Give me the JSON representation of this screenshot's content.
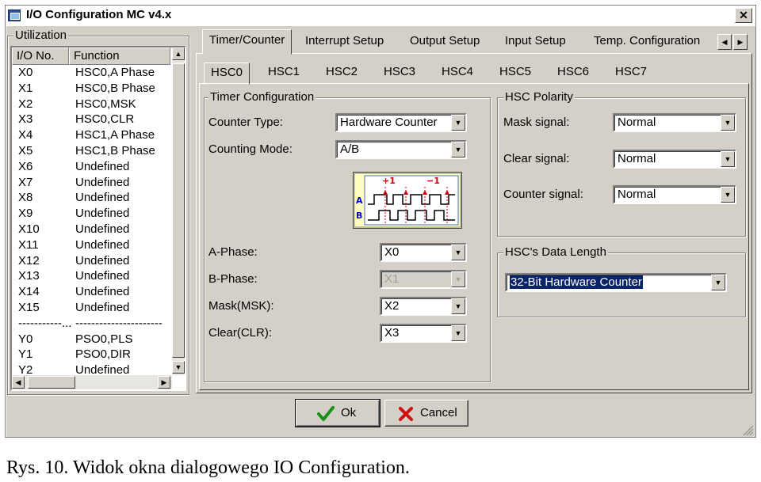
{
  "window": {
    "title": "I/O Configuration MC v4.x",
    "close_label": "✕"
  },
  "utilization": {
    "label": "Utilization",
    "columns": [
      "I/O No.",
      "Function"
    ],
    "rows": [
      {
        "io": "X0",
        "fn": "HSC0,A Phase"
      },
      {
        "io": "X1",
        "fn": "HSC0,B Phase"
      },
      {
        "io": "X2",
        "fn": "HSC0,MSK"
      },
      {
        "io": "X3",
        "fn": "HSC0,CLR"
      },
      {
        "io": "X4",
        "fn": "HSC1,A Phase"
      },
      {
        "io": "X5",
        "fn": "HSC1,B Phase"
      },
      {
        "io": "X6",
        "fn": "Undefined"
      },
      {
        "io": "X7",
        "fn": "Undefined"
      },
      {
        "io": "X8",
        "fn": "Undefined"
      },
      {
        "io": "X9",
        "fn": "Undefined"
      },
      {
        "io": "X10",
        "fn": "Undefined"
      },
      {
        "io": "X11",
        "fn": "Undefined"
      },
      {
        "io": "X12",
        "fn": "Undefined"
      },
      {
        "io": "X13",
        "fn": "Undefined"
      },
      {
        "io": "X14",
        "fn": "Undefined"
      },
      {
        "io": "X15",
        "fn": "Undefined"
      },
      {
        "io": "-----------...",
        "fn": "----------------------"
      },
      {
        "io": "Y0",
        "fn": "PSO0,PLS"
      },
      {
        "io": "Y1",
        "fn": "PSO0,DIR"
      },
      {
        "io": "Y2",
        "fn": "Undefined"
      }
    ]
  },
  "tabs": [
    "Timer/Counter",
    "Interrupt Setup",
    "Output Setup",
    "Input Setup",
    "Temp. Configuration"
  ],
  "active_tab": "Timer/Counter",
  "hsc_tabs": [
    "HSC0",
    "HSC1",
    "HSC2",
    "HSC3",
    "HSC4",
    "HSC5",
    "HSC6",
    "HSC7"
  ],
  "active_hsc": "HSC0",
  "timer_config": {
    "label": "Timer Configuration",
    "counter_type_label": "Counter Type:",
    "counter_type_value": "Hardware Counter",
    "counting_mode_label": "Counting Mode:",
    "counting_mode_value": "A/B",
    "diagram": {
      "plus": "+1",
      "minus": "−1",
      "a": "A",
      "b": "B"
    },
    "a_phase_label": "A-Phase:",
    "a_phase_value": "X0",
    "b_phase_label": "B-Phase:",
    "b_phase_value": "X1",
    "mask_label": "Mask(MSK):",
    "mask_value": "X2",
    "clear_label": "Clear(CLR):",
    "clear_value": "X3"
  },
  "hsc_polarity": {
    "label": "HSC Polarity",
    "mask_signal_label": "Mask signal:",
    "mask_signal_value": "Normal",
    "clear_signal_label": "Clear signal:",
    "clear_signal_value": "Normal",
    "counter_signal_label": "Counter signal:",
    "counter_signal_value": "Normal"
  },
  "data_length": {
    "label": "HSC's Data Length",
    "value": "32-Bit Hardware Counter"
  },
  "buttons": {
    "ok": "Ok",
    "cancel": "Cancel"
  },
  "caption": "Rys. 10. Widok okna dialogowego IO Configuration."
}
